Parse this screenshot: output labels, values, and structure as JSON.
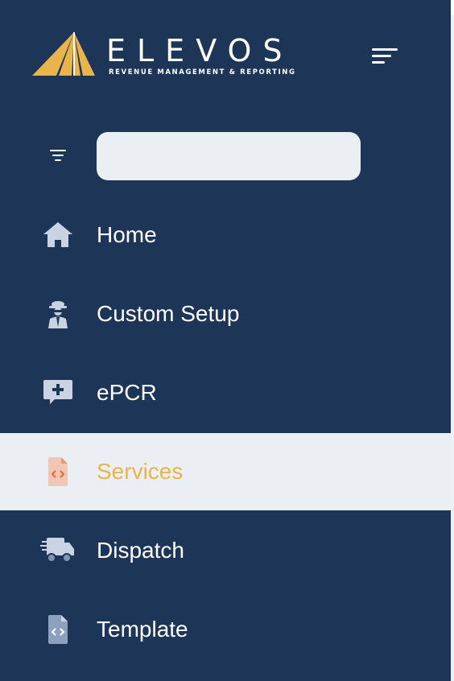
{
  "brand": {
    "name": "ELEVOS",
    "tagline": "REVENUE MANAGEMENT & REPORTING",
    "mark_colors": [
      "#e9b44c",
      "#ffffff"
    ]
  },
  "header": {
    "menu_toggle_icon": "menu-icon"
  },
  "search": {
    "value": "",
    "placeholder": "",
    "filter_icon": "filter-icon"
  },
  "nav": {
    "items": [
      {
        "label": "Home",
        "icon": "home-icon",
        "active": false
      },
      {
        "label": "Custom Setup",
        "icon": "agent-icon",
        "active": false
      },
      {
        "label": "ePCR",
        "icon": "comment-plus-icon",
        "active": false
      },
      {
        "label": "Services",
        "icon": "file-code-icon",
        "active": true
      },
      {
        "label": "Dispatch",
        "icon": "truck-icon",
        "active": false
      },
      {
        "label": "Template",
        "icon": "file-code-icon",
        "active": false
      }
    ]
  },
  "colors": {
    "sidebar_bg": "#1d3557",
    "active_bg": "#ebeef2",
    "active_text": "#e9b44c",
    "icon_muted": "#c9d3e2",
    "active_icon": "#e79a73"
  }
}
